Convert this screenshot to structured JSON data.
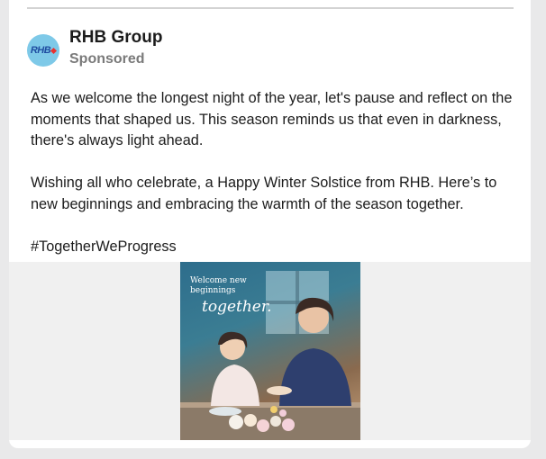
{
  "post": {
    "page_name": "RHB Group",
    "sponsored_label": "Sponsored",
    "avatar_text": "RHB",
    "paragraphs": [
      "As we welcome the longest night of the year, let's pause and reflect on the moments that shaped us. This season reminds us that even in darkness, there's always light ahead.",
      "Wishing all who celebrate, a Happy Winter Solstice from RHB. Here’s to new beginnings and embracing the warmth of the season together.",
      "#TogetherWeProgress"
    ],
    "image": {
      "caption_line1": "Welcome new",
      "caption_line2": "beginnings",
      "caption_script": "together."
    }
  },
  "colors": {
    "brand_blue": "#1f4da1",
    "brand_red": "#e8312f",
    "avatar_bg": "#7ec9e8"
  },
  "icons": [
    "rhb-logo-icon"
  ]
}
